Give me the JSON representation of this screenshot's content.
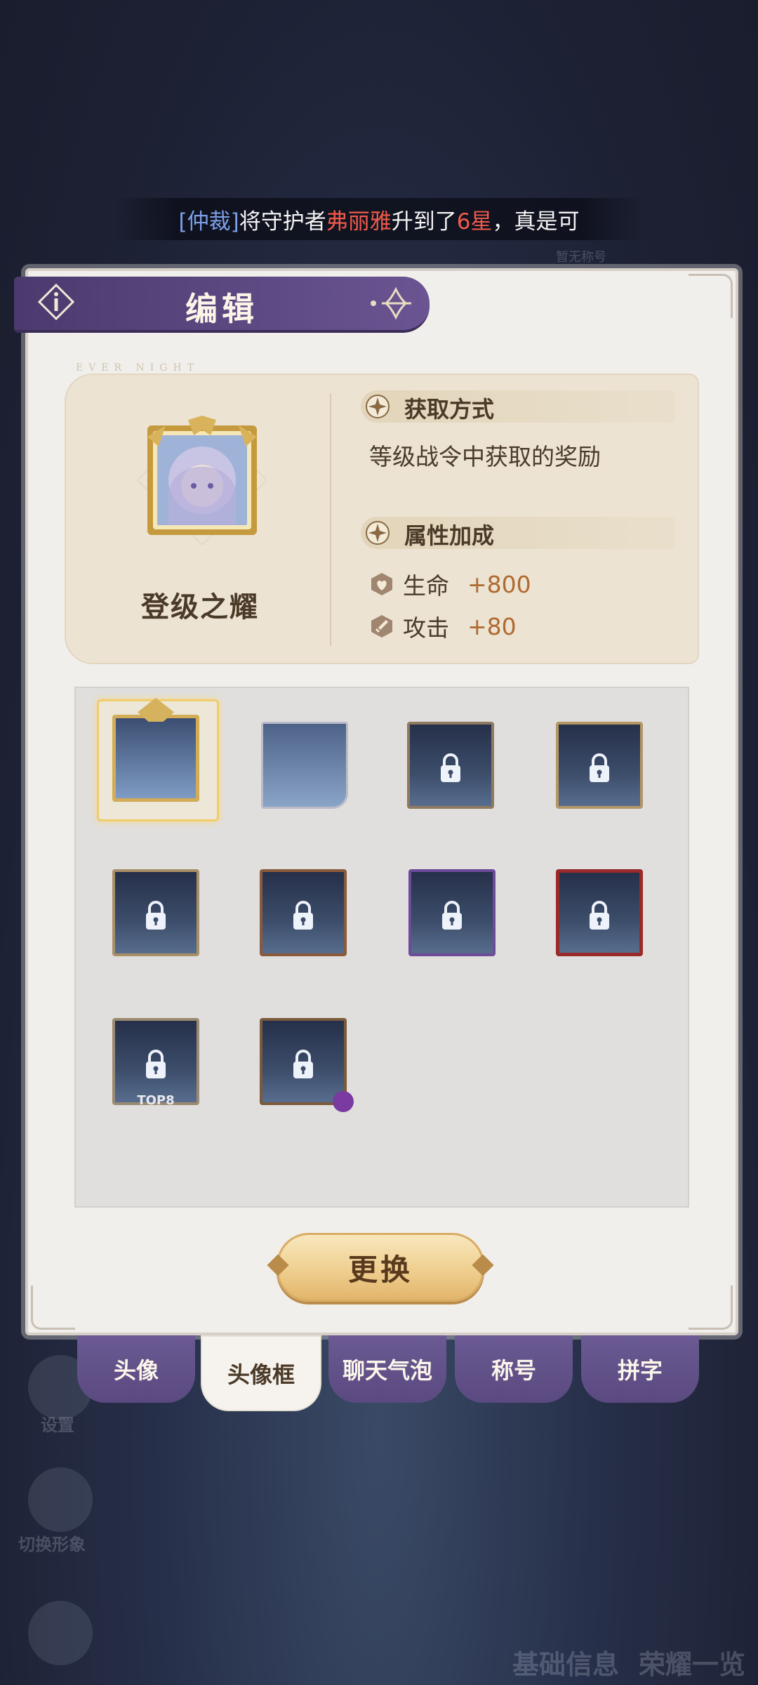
{
  "ticker": {
    "prefix": "[仲裁]",
    "mid1": "将守护者",
    "name": "弗丽雅",
    "mid2": "升到了",
    "stars": "6星",
    "suffix": "，真是可"
  },
  "background": {
    "faded_label": "暂无称号",
    "left_button_1": "设置",
    "left_button_2": "切换形象",
    "bottom_right_1": "基础信息",
    "bottom_right_2": "荣耀一览"
  },
  "header": {
    "title": "编辑"
  },
  "detail": {
    "watermark": "EVER NIGHT",
    "item_name": "登级之耀",
    "acquire_title": "获取方式",
    "acquire_text": "等级战令中获取的奖励",
    "attr_title": "属性加成",
    "stats": [
      {
        "label": "生命",
        "value": "+800",
        "icon": "heart-shield-icon"
      },
      {
        "label": "攻击",
        "value": "+80",
        "icon": "sword-icon"
      }
    ]
  },
  "frames": [
    {
      "id": "frame-1",
      "locked": false,
      "selected": true
    },
    {
      "id": "frame-2",
      "locked": false,
      "selected": false
    },
    {
      "id": "frame-3",
      "locked": true
    },
    {
      "id": "frame-4",
      "locked": true
    },
    {
      "id": "frame-5",
      "locked": true
    },
    {
      "id": "frame-6",
      "locked": true
    },
    {
      "id": "frame-7",
      "locked": true
    },
    {
      "id": "frame-8",
      "locked": true
    },
    {
      "id": "frame-9",
      "locked": true,
      "tag": "TOP8"
    },
    {
      "id": "frame-10",
      "locked": true
    }
  ],
  "change_button": {
    "label": "更换"
  },
  "tabs": [
    {
      "label": "头像",
      "active": false
    },
    {
      "label": "头像框",
      "active": true
    },
    {
      "label": "聊天气泡",
      "active": false
    },
    {
      "label": "称号",
      "active": false
    },
    {
      "label": "拼字",
      "active": false
    }
  ],
  "colors": {
    "panel_bg": "#f1efec",
    "header_purple": "#5a4a80",
    "accent_gold": "#e2b56b",
    "highlight_red": "#f05a4a",
    "highlight_blue": "#7ca0e8"
  }
}
